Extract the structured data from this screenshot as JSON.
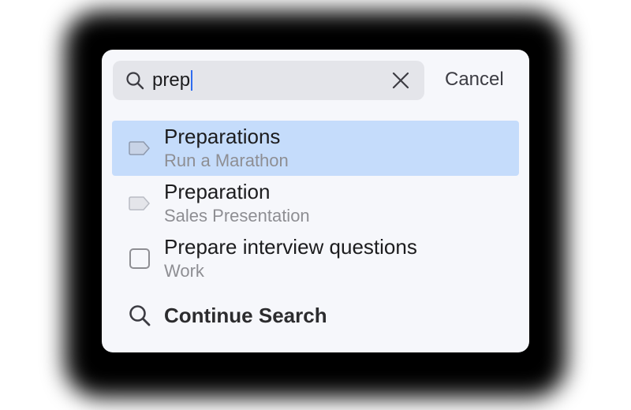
{
  "search": {
    "query": "prep",
    "cancel_label": "Cancel"
  },
  "results": [
    {
      "title": "Preparations",
      "subtitle": "Run a Marathon",
      "icon": "tag-icon",
      "selected": true
    },
    {
      "title": "Preparation",
      "subtitle": "Sales Presentation",
      "icon": "tag-icon",
      "selected": false
    },
    {
      "title": "Prepare interview questions",
      "subtitle": "Work",
      "icon": "checkbox-icon",
      "selected": false
    }
  ],
  "continue_search": {
    "label": "Continue Search",
    "icon": "search-icon"
  },
  "colors": {
    "selection": "#c5dcfb",
    "caret": "#2f6cf0",
    "subtitle": "#8e8e93"
  }
}
